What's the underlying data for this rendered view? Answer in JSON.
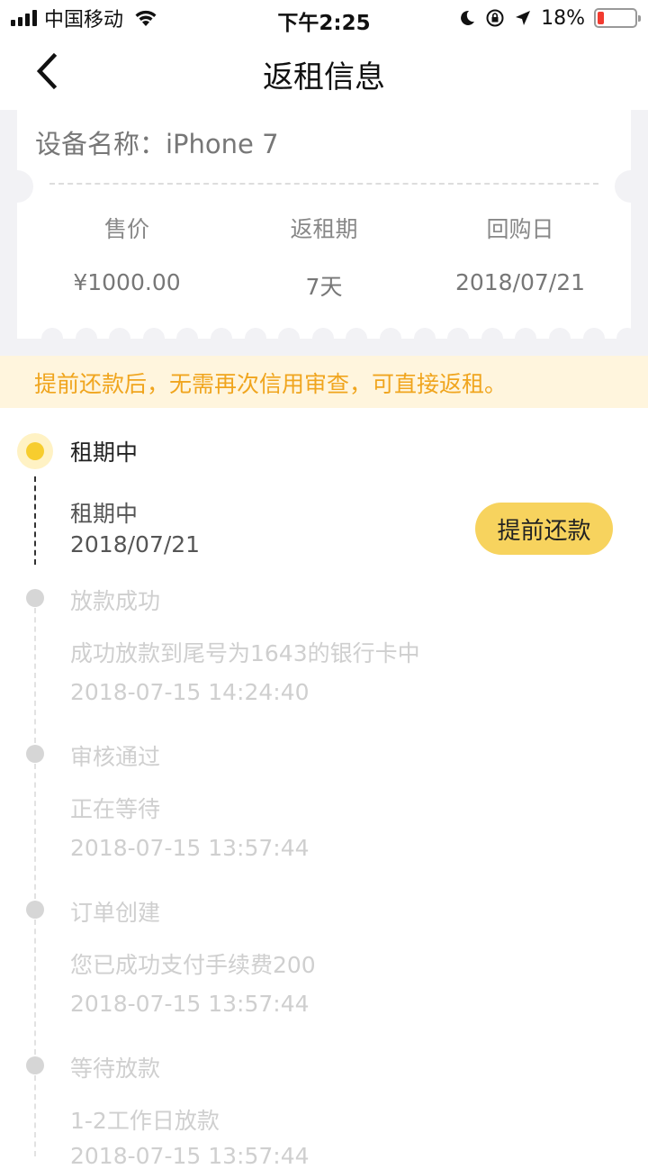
{
  "status_bar": {
    "carrier": "中国移动",
    "time": "下午2:25",
    "battery_percent": "18%",
    "battery_level": 0.18,
    "icons": [
      "signal-icon",
      "wifi-icon",
      "moon-icon",
      "rotation-lock-icon",
      "location-arrow-icon",
      "battery-icon"
    ]
  },
  "nav": {
    "title": "返租信息",
    "back_icon": "chevron-left-icon"
  },
  "device": {
    "label": "设备名称：iPhone 7"
  },
  "info": {
    "columns": [
      {
        "label": "售价",
        "value": "¥1000.00"
      },
      {
        "label": "返租期",
        "value": "7天"
      },
      {
        "label": "回购日",
        "value": "2018/07/21"
      }
    ]
  },
  "notice": {
    "text": "提前还款后，无需再次信用审查，可直接返租。"
  },
  "timeline": {
    "current": {
      "title": "租期中",
      "status": "租期中",
      "date": "2018/07/21",
      "button_label": "提前还款"
    },
    "steps": [
      {
        "title": "放款成功",
        "detail": "成功放款到尾号为1643的银行卡中",
        "time": "2018-07-15 14:24:40"
      },
      {
        "title": "审核通过",
        "detail": "正在等待",
        "time": "2018-07-15 13:57:44"
      },
      {
        "title": "订单创建",
        "detail": "您已成功支付手续费200",
        "time": "2018-07-15 13:57:44"
      },
      {
        "title": "等待放款",
        "detail": "1-2工作日放款",
        "time": "2018-07-15 13:57:44"
      }
    ]
  },
  "colors": {
    "accent_yellow": "#f7cd2e",
    "button_yellow": "#f7d35e",
    "notice_bg": "#fff5dd",
    "notice_text": "#f0a51e",
    "battery_red": "#f23b30"
  }
}
